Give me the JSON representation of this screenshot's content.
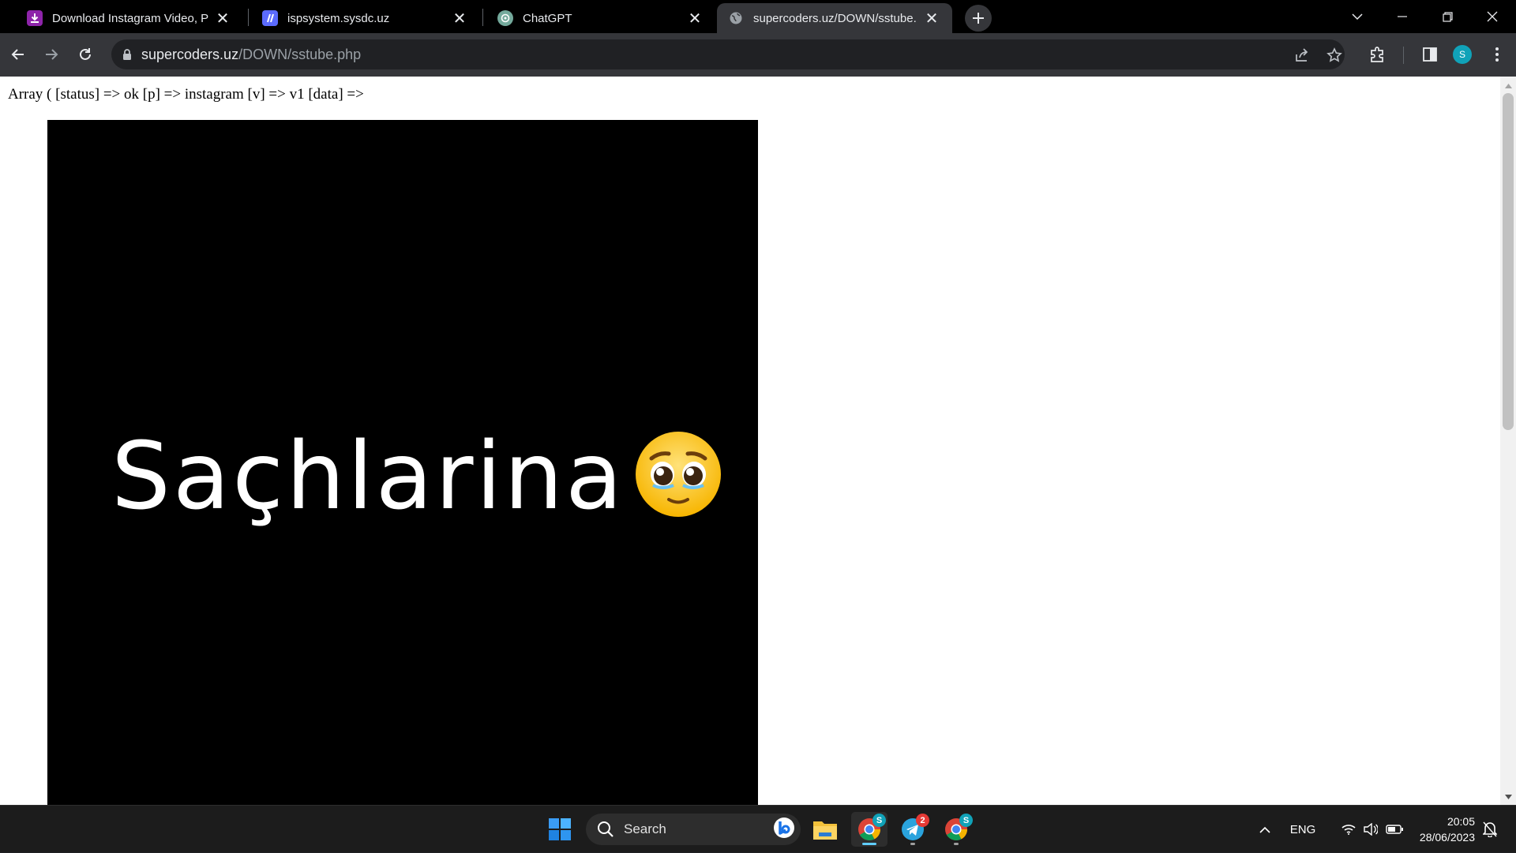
{
  "browser": {
    "tabs": [
      {
        "title": "Download Instagram Video, Ph",
        "favicon": "download-icon",
        "active": false
      },
      {
        "title": "ispsystem.sysdc.uz",
        "favicon": "ispsystem-icon",
        "active": false
      },
      {
        "title": "ChatGPT",
        "favicon": "chatgpt-icon",
        "active": false
      },
      {
        "title": "supercoders.uz/DOWN/sstube.",
        "favicon": "globe-icon",
        "active": true
      }
    ],
    "address": {
      "host": "supercoders.uz",
      "path": "/DOWN/sstube.php"
    },
    "profile_initial": "S",
    "colors": {
      "tab_bar": "#000000",
      "toolbar": "#35363a",
      "omnibox": "#202124",
      "profile": "#10a2b8"
    }
  },
  "page": {
    "php_output": "Array ( [status] => ok [p] => instagram [v] => v1 [data] =>",
    "video_caption": "Saçhlarina",
    "video_emoji": "pleading-face-emoji"
  },
  "taskbar": {
    "search_label": "Search",
    "apps": [
      {
        "name": "file-explorer-icon",
        "badge": ""
      },
      {
        "name": "chrome-profile-s-icon",
        "badge": "S"
      },
      {
        "name": "telegram-icon",
        "badge": "2"
      },
      {
        "name": "chrome-profile-s-icon-2",
        "badge": "S"
      }
    ],
    "language": "ENG",
    "time": "20:05",
    "date": "28/06/2023"
  }
}
